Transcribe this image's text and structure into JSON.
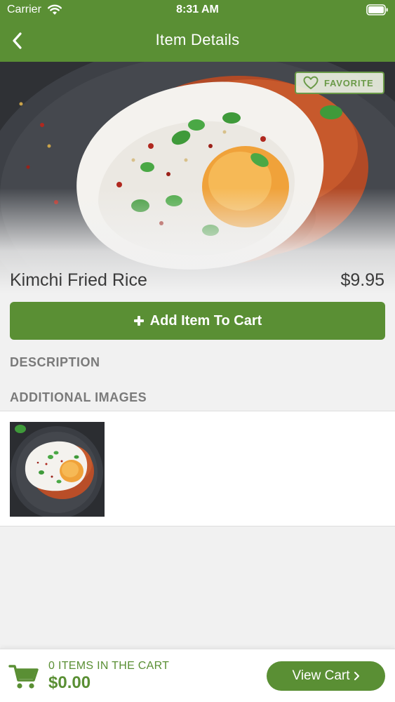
{
  "status_bar": {
    "carrier": "Carrier",
    "time": "8:31 AM"
  },
  "nav": {
    "title": "Item Details",
    "back_icon": "chevron-left-icon"
  },
  "item": {
    "name": "Kimchi Fried Rice",
    "price": "$9.95",
    "favorite_label": "FAVORITE",
    "add_to_cart_label": "Add Item To Cart"
  },
  "sections": {
    "description": "DESCRIPTION",
    "additional_images": "ADDITIONAL IMAGES"
  },
  "cart": {
    "count_text": "0 ITEMS IN THE CART",
    "total": "$0.00",
    "view_cart_label": "View Cart"
  },
  "colors": {
    "brand_green": "#5a8f34",
    "favorite_green": "#6a9a48",
    "background": "#f1f1f1"
  }
}
